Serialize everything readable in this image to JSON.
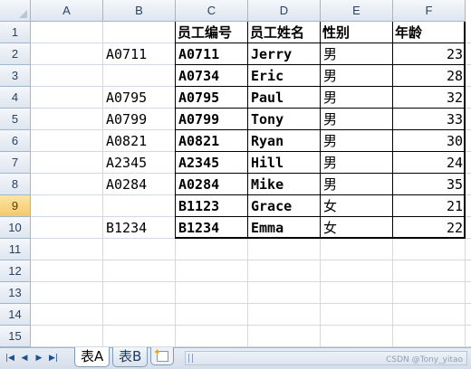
{
  "columns": [
    "A",
    "B",
    "C",
    "D",
    "E",
    "F"
  ],
  "rows": [
    "1",
    "2",
    "3",
    "4",
    "5",
    "6",
    "7",
    "8",
    "9",
    "10",
    "11",
    "12",
    "13",
    "14",
    "15"
  ],
  "selected_row": "9",
  "column_b_values": [
    "",
    "A0711",
    "",
    "A0795",
    "A0799",
    "A0821",
    "A2345",
    "A0284",
    "",
    "B1234"
  ],
  "table": {
    "headers": [
      "员工编号",
      "员工姓名",
      "性别",
      "年龄"
    ],
    "rows": [
      [
        "A0711",
        "Jerry",
        "男",
        "23"
      ],
      [
        "A0734",
        "Eric",
        "男",
        "28"
      ],
      [
        "A0795",
        "Paul",
        "男",
        "32"
      ],
      [
        "A0799",
        "Tony",
        "男",
        "33"
      ],
      [
        "A0821",
        "Ryan",
        "男",
        "30"
      ],
      [
        "A2345",
        "Hill",
        "男",
        "24"
      ],
      [
        "A0284",
        "Mike",
        "男",
        "35"
      ],
      [
        "B1123",
        "Grace",
        "女",
        "21"
      ],
      [
        "B1234",
        "Emma",
        "女",
        "22"
      ]
    ]
  },
  "sheet_tabs": [
    {
      "label": "表A",
      "active": true
    },
    {
      "label": "表B",
      "active": false
    }
  ],
  "nav_icons": [
    "first-sheet-icon",
    "prev-sheet-icon",
    "next-sheet-icon",
    "last-sheet-icon"
  ],
  "watermark": "CSDN @Tony_yitao",
  "colors": {
    "header_bg": "#dfe6ef",
    "selected_row_header": "#f6c86a",
    "gridline": "#d0d7e5"
  }
}
